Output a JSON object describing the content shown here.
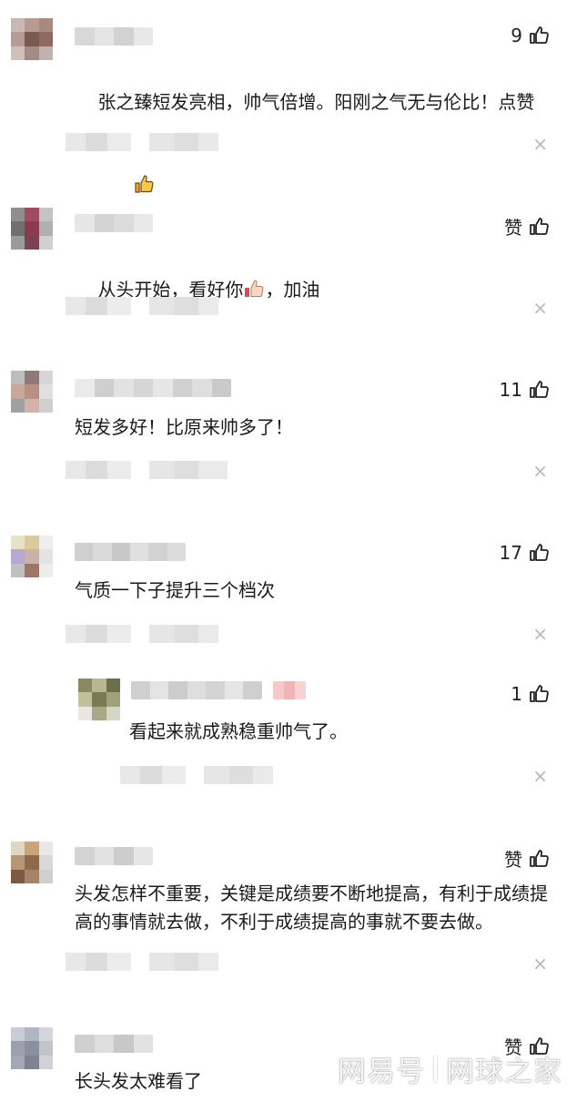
{
  "comments": [
    {
      "text": "张之臻短发亮相，帅气倍增。阳刚之气无与伦比！点赞",
      "likes": "9",
      "emoji": "thumbs-up"
    },
    {
      "text": "从头开始，看好你",
      "text_suffix": "，加油",
      "likes": "赞",
      "emoji": "thumbs-up"
    },
    {
      "text": "短发多好！比原来帅多了！",
      "likes": "11"
    },
    {
      "text": "气质一下子提升三个档次",
      "likes": "17"
    },
    {
      "text": "看起来就成熟稳重帅气了。",
      "likes": "1",
      "reply": true
    },
    {
      "text": "头发怎样不重要，关键是成绩要不断地提高，有利于成绩提高的事情就去做，不利于成绩提高的事就不要去做。",
      "likes": "赞"
    },
    {
      "text": "长头发太难看了",
      "likes": "赞"
    }
  ],
  "close_glyph": "×",
  "watermark": {
    "left": "网易号",
    "right": "网球之家"
  },
  "colors": {
    "text": "#1a1a1a",
    "close": "#b8b8b8",
    "blur_light": "#e6e6e6"
  }
}
